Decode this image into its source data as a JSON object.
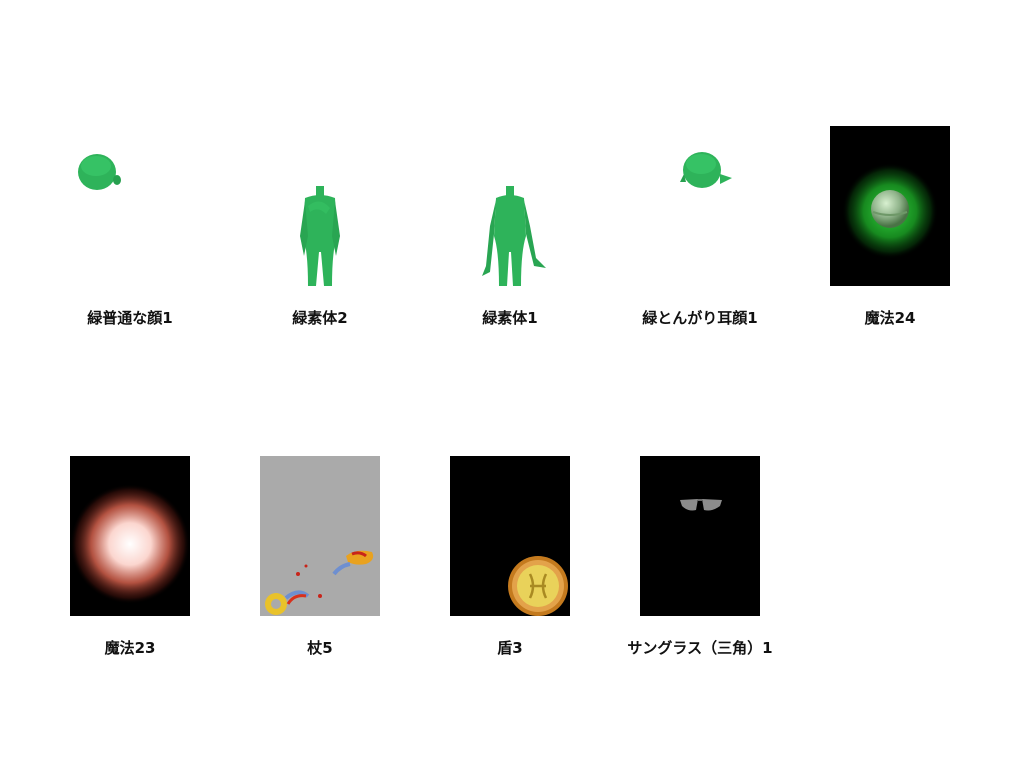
{
  "gallery": {
    "items": [
      {
        "label": "緑普通な顔1",
        "icon": "green-head-icon"
      },
      {
        "label": "緑素体2",
        "icon": "green-body-icon"
      },
      {
        "label": "緑素体1",
        "icon": "green-body-icon"
      },
      {
        "label": "緑とんがり耳顔1",
        "icon": "green-pointy-ear-head-icon"
      },
      {
        "label": "魔法24",
        "icon": "green-magic-orb-icon"
      },
      {
        "label": "魔法23",
        "icon": "red-magic-glow-icon"
      },
      {
        "label": "杖5",
        "icon": "staff-icon"
      },
      {
        "label": "盾3",
        "icon": "shield-icon"
      },
      {
        "label": "サングラス（三角）1",
        "icon": "sunglasses-icon"
      }
    ]
  },
  "colors": {
    "skin_green": "#2eb35a",
    "thumb_dark": "#000000",
    "thumb_grey": "#aaaaaa"
  }
}
